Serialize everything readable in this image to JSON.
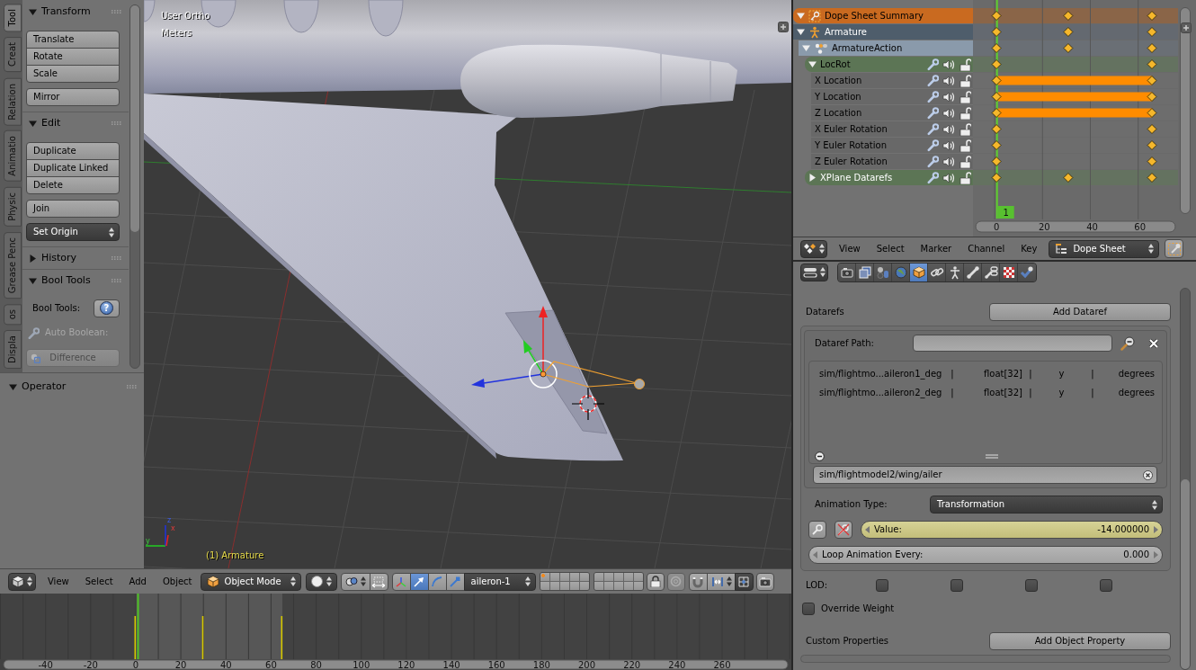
{
  "tool_shelf": {
    "tabs": [
      {
        "label": "Tool",
        "selected": true
      },
      {
        "label": "Creat",
        "selected": false
      },
      {
        "label": "Relation",
        "selected": false
      },
      {
        "label": "Animatio",
        "selected": false
      },
      {
        "label": "Physic",
        "selected": false
      },
      {
        "label": "Grease Penc",
        "selected": false
      },
      {
        "label": "os",
        "selected": false
      },
      {
        "label": "Displa",
        "selected": false
      }
    ],
    "panels": [
      {
        "title": "Transform",
        "expanded": true,
        "items": [
          {
            "kind": "button_group",
            "disabled": false,
            "buttons": [
              "Translate",
              "Rotate",
              "Scale"
            ]
          },
          {
            "kind": "button_group",
            "disabled": false,
            "buttons": [
              "Mirror"
            ]
          }
        ]
      },
      {
        "title": "Edit",
        "expanded": true,
        "items": [
          {
            "kind": "button_group",
            "disabled": false,
            "buttons": [
              "Duplicate",
              "Duplicate Linked",
              "Delete"
            ]
          },
          {
            "kind": "button_group",
            "disabled": false,
            "buttons": [
              "Join"
            ]
          },
          {
            "kind": "dropdown",
            "disabled": false,
            "label": "Set Origin"
          }
        ]
      },
      {
        "title": "History",
        "expanded": false
      },
      {
        "title": "Bool Tools",
        "expanded": true,
        "items": [
          {
            "kind": "help_row",
            "disabled": false,
            "label": "Bool Tools:",
            "symbol": "?"
          },
          {
            "kind": "tool_label",
            "disabled": true,
            "label": "Auto Boolean:"
          },
          {
            "kind": "icon_button_group",
            "disabled": true,
            "buttons": [
              "Difference"
            ]
          }
        ]
      }
    ],
    "operator_panel": {
      "title": "Operator",
      "expanded": true
    }
  },
  "viewport": {
    "view_name": "User Ortho",
    "units": "Meters",
    "active_object": {
      "label": "(1) Armature",
      "keyed": true
    },
    "axis_labels": [
      "z",
      "x",
      "y"
    ]
  },
  "view3d_header": {
    "menus": [
      "View",
      "Select",
      "Add",
      "Object"
    ],
    "mode": "Object Mode",
    "manipulators": [
      {
        "on": false
      },
      {
        "on": true
      },
      {
        "on": false
      },
      {
        "on": false
      }
    ],
    "orientation": "aileron-1",
    "layers": [
      {
        "used": true
      },
      {
        "used": false
      },
      {
        "used": false
      },
      {
        "used": false
      },
      {
        "used": false
      },
      {
        "used": false
      },
      {
        "used": false
      },
      {
        "used": false
      },
      {
        "used": false
      },
      {
        "used": false
      },
      {
        "used": false
      },
      {
        "used": false
      },
      {
        "used": false
      },
      {
        "used": false
      },
      {
        "used": false
      },
      {
        "used": false
      },
      {
        "used": false
      },
      {
        "used": false
      },
      {
        "used": false
      },
      {
        "used": false
      }
    ]
  },
  "timeline": {
    "keyframe_marks": [
      {
        "on": true
      },
      {
        "on": true
      },
      {
        "on": true
      }
    ],
    "ruler_labels": [
      "-40",
      "-20",
      "0",
      "20",
      "40",
      "60",
      "80",
      "100",
      "120",
      "140",
      "160",
      "180",
      "200",
      "220",
      "240",
      "260"
    ]
  },
  "dope_sheet": {
    "channels": [
      {
        "label": "Dope Sheet Summary",
        "kind": "summary",
        "expanded": true,
        "selected": false,
        "keyframes": [
          true,
          true,
          true
        ],
        "children": [
          {
            "label": "Armature",
            "kind": "object",
            "expanded": true,
            "selected": true,
            "keyframes": [
              true,
              true,
              true
            ],
            "children": [
              {
                "label": "ArmatureAction",
                "kind": "action",
                "expanded": true,
                "selected": false,
                "keyframes": [
                  true,
                  true,
                  true
                ],
                "children": [
                  {
                    "label": "LocRot",
                    "kind": "group",
                    "expanded": true,
                    "selected": false,
                    "muted": false,
                    "locked": false,
                    "keyframes": [
                      true,
                      false,
                      true
                    ],
                    "children": [
                      {
                        "label": "X Location",
                        "kind": "fcurve",
                        "selected": false,
                        "muted": false,
                        "locked": false,
                        "keyframes": [
                          true,
                          false,
                          true
                        ],
                        "hold": true
                      },
                      {
                        "label": "Y Location",
                        "kind": "fcurve",
                        "selected": false,
                        "muted": false,
                        "locked": false,
                        "keyframes": [
                          true,
                          false,
                          true
                        ],
                        "hold": true
                      },
                      {
                        "label": "Z Location",
                        "kind": "fcurve",
                        "selected": false,
                        "muted": false,
                        "locked": false,
                        "keyframes": [
                          true,
                          false,
                          true
                        ],
                        "hold": true
                      },
                      {
                        "label": "X Euler Rotation",
                        "kind": "fcurve",
                        "selected": false,
                        "muted": false,
                        "locked": false,
                        "keyframes": [
                          true,
                          false,
                          true
                        ],
                        "hold": false
                      },
                      {
                        "label": "Y Euler Rotation",
                        "kind": "fcurve",
                        "selected": false,
                        "muted": false,
                        "locked": false,
                        "keyframes": [
                          true,
                          false,
                          true
                        ],
                        "hold": false
                      },
                      {
                        "label": "Z Euler Rotation",
                        "kind": "fcurve",
                        "selected": false,
                        "muted": false,
                        "locked": false,
                        "keyframes": [
                          true,
                          false,
                          true
                        ],
                        "hold": false
                      }
                    ]
                  },
                  {
                    "label": "XPlane Datarefs",
                    "kind": "group",
                    "expanded": false,
                    "selected": true,
                    "muted": false,
                    "locked": false,
                    "keyframes": [
                      true,
                      true,
                      true
                    ]
                  }
                ]
              }
            ]
          }
        ]
      }
    ],
    "current_frame": "1",
    "ruler_labels": [
      "0",
      "20",
      "40",
      "60"
    ],
    "header": {
      "menus": [
        "View",
        "Select",
        "Marker",
        "Channel",
        "Key"
      ],
      "mode": "Dope Sheet"
    }
  },
  "properties": {
    "context_tabs": [
      {
        "selected": false
      },
      {
        "selected": false
      },
      {
        "selected": false
      },
      {
        "selected": false
      },
      {
        "selected": true
      },
      {
        "selected": false
      },
      {
        "selected": false
      },
      {
        "selected": false
      },
      {
        "selected": false
      },
      {
        "selected": false
      },
      {
        "selected": false
      }
    ],
    "datarefs": {
      "label": "Datarefs",
      "button": "Add Dataref"
    },
    "dataref_path": {
      "label": "Dataref Path:"
    },
    "dataref_list": {
      "rows": [
        {
          "cells": [
            "sim/flightmo...aileron1_deg",
            "|",
            "float[32]",
            "|",
            "y",
            "|",
            "degrees"
          ]
        },
        {
          "cells": [
            "sim/flightmo...aileron2_deg",
            "|",
            "float[32]",
            "|",
            "y",
            "|",
            "degrees"
          ]
        }
      ]
    },
    "dataref_field": {
      "value": "sim/flightmodel2/wing/ailer"
    },
    "animation_type": {
      "label": "Animation Type:",
      "value": "Transformation"
    },
    "value_field": {
      "label": "Value:",
      "value": "-14.000000",
      "keyed": true
    },
    "loop_field": {
      "label": "Loop Animation Every:",
      "value": "0.000"
    },
    "lod": {
      "label": "LOD:",
      "checkboxes": [
        {
          "checked": false
        },
        {
          "checked": false
        },
        {
          "checked": false
        },
        {
          "checked": false
        }
      ]
    },
    "override_weight": {
      "label": "Override Weight",
      "checked": false
    },
    "custom_properties": {
      "label": "Custom Properties",
      "button": "Add Object Property"
    }
  }
}
